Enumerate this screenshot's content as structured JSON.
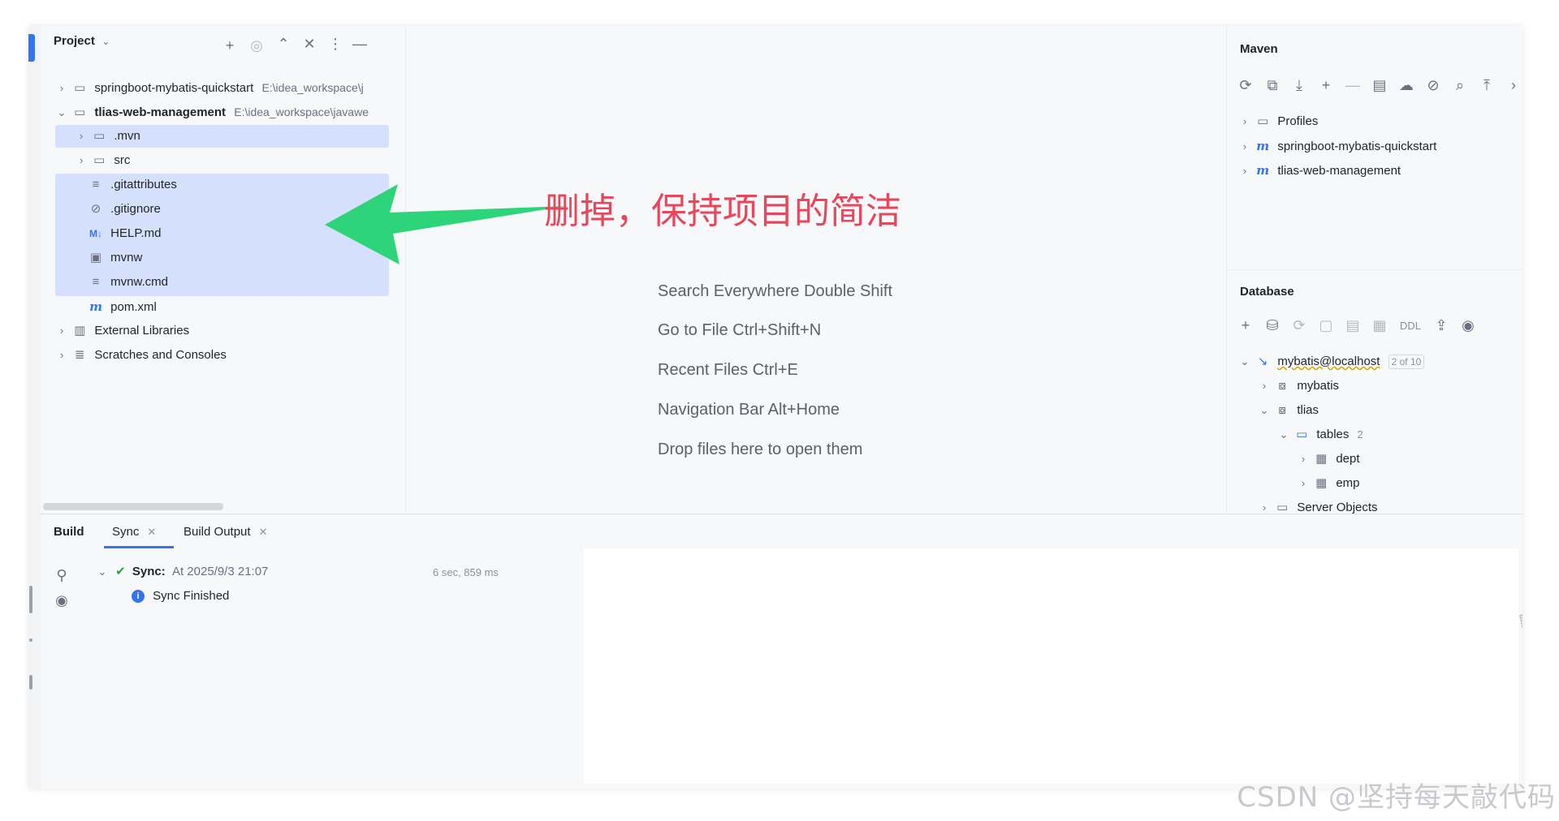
{
  "project": {
    "title": "Project",
    "tree": [
      {
        "label": "springboot-mybatis-quickstart",
        "path": "E:\\idea_workspace\\j"
      },
      {
        "label": "tlias-web-management",
        "path": "E:\\idea_workspace\\javawe"
      },
      {
        "label": ".mvn"
      },
      {
        "label": "src"
      },
      {
        "label": ".gitattributes"
      },
      {
        "label": ".gitignore"
      },
      {
        "label": "HELP.md",
        "icon_text": "M↓"
      },
      {
        "label": "mvnw"
      },
      {
        "label": "mvnw.cmd"
      },
      {
        "label": "pom.xml",
        "icon_text": "m"
      },
      {
        "label": "External Libraries"
      },
      {
        "label": "Scratches and Consoles"
      }
    ]
  },
  "annotation": {
    "text": "删掉，保持项目的简洁",
    "color": "#e8465a",
    "arrow_color": "#2ed47a"
  },
  "editor": {
    "hints": [
      "Search Everywhere Double Shift",
      "Go to File Ctrl+Shift+N",
      "Recent Files Ctrl+E",
      "Navigation Bar Alt+Home",
      "Drop files here to open them"
    ]
  },
  "maven": {
    "title": "Maven",
    "items": [
      {
        "label": "Profiles"
      },
      {
        "label": "springboot-mybatis-quickstart",
        "icon_text": "m"
      },
      {
        "label": "tlias-web-management",
        "icon_text": "m"
      }
    ]
  },
  "database": {
    "title": "Database",
    "ddl_label": "DDL",
    "items": [
      {
        "label": "mybatis@localhost",
        "badge": "2 of 10"
      },
      {
        "label": "mybatis"
      },
      {
        "label": "tlias"
      },
      {
        "label": "tables",
        "count": "2"
      },
      {
        "label": "dept"
      },
      {
        "label": "emp"
      },
      {
        "label": "Server Objects"
      }
    ]
  },
  "build": {
    "title": "Build",
    "tabs": [
      {
        "label": "Sync"
      },
      {
        "label": "Build Output"
      }
    ],
    "sync_label": "Sync:",
    "sync_time": "At 2025/9/3 21:07",
    "duration": "6 sec, 859 ms",
    "finished": "Sync Finished"
  },
  "watermark": "CSDN @坚持每天敲代码",
  "colors": {
    "accent": "#3574f0",
    "selection": "#d5e1fc",
    "success": "#2f9e44"
  }
}
